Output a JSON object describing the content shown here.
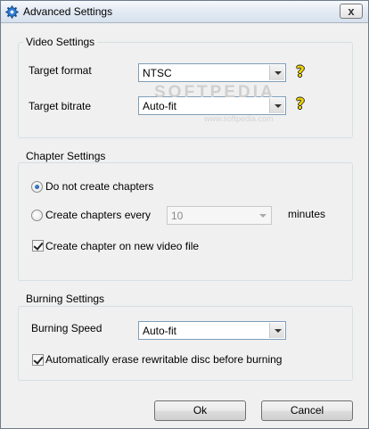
{
  "window": {
    "title": "Advanced Settings",
    "close_label": "x"
  },
  "video": {
    "group_label": "Video Settings",
    "target_format_label": "Target format",
    "target_format_value": "NTSC",
    "target_bitrate_label": "Target bitrate",
    "target_bitrate_value": "Auto-fit",
    "help_glyph": "?"
  },
  "chapter": {
    "group_label": "Chapter Settings",
    "no_chapters_label": "Do not create chapters",
    "every_label": "Create chapters every",
    "every_value": "10",
    "minutes_label": "minutes",
    "new_file_label": "Create chapter on new video file"
  },
  "burning": {
    "group_label": "Burning Settings",
    "speed_label": "Burning Speed",
    "speed_value": "Auto-fit",
    "erase_label": "Automatically erase rewritable disc before burning"
  },
  "buttons": {
    "ok": "Ok",
    "cancel": "Cancel"
  },
  "watermark": {
    "main": "SOFTPEDIA",
    "sub": "www.softpedia.com"
  }
}
